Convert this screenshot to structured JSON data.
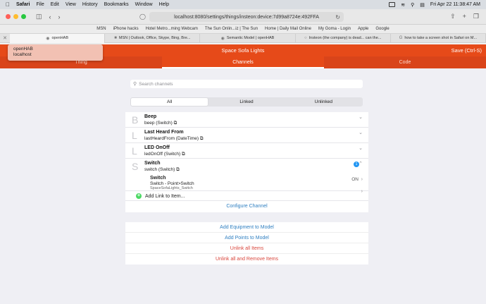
{
  "menubar": {
    "app": "Safari",
    "items": [
      "File",
      "Edit",
      "View",
      "History",
      "Bookmarks",
      "Window",
      "Help"
    ],
    "datetime": "Fri Apr 22  11:38:47 AM"
  },
  "browser": {
    "url": "localhost:8080/settings/things/insteon:device:7d99a8724e:492FFA",
    "favorites": [
      "MSN",
      "iPhone hacks",
      "Hotel Metro...ming Webcam",
      "The Sun Onlin...iz | The Sun",
      "Home | Daily Mail Online",
      "My Goma - Login",
      "Apple",
      "Google"
    ],
    "tabs": [
      "openHAB",
      "MSN | Outlook, Office, Skype, Bing, Bre...",
      "Semantic Model | openHAB",
      "Insteon (the company) is dead... can the...",
      "how to take a screen shot in Safari on M..."
    ]
  },
  "header": {
    "title": "Space Sofa Lights",
    "save": "Save (Ctrl-S)"
  },
  "server_popup": {
    "name": "openHAB",
    "host": "localhost"
  },
  "tabs": [
    "Thing",
    "Channels",
    "Code"
  ],
  "search": {
    "placeholder": "Search channels"
  },
  "filter": [
    "All",
    "Linked",
    "Unlinked"
  ],
  "channels": [
    {
      "letter": "B",
      "name": "Beep",
      "sub": "beep (Switch)"
    },
    {
      "letter": "L",
      "name": "Last Heard From",
      "sub": "lastHeardFrom (DateTime)"
    },
    {
      "letter": "L",
      "name": "LED OnOff",
      "sub": "ledOnOff (Switch)"
    },
    {
      "letter": "S",
      "name": "Switch",
      "sub": "switch (Switch)",
      "badge": "1"
    }
  ],
  "linked_item": {
    "name": "Switch",
    "sub": "Switch - Point>Switch",
    "id": "SpaceSofaLights_Switch",
    "state": "ON"
  },
  "add_link": "Add Link to Item...",
  "configure": "Configure Channel",
  "actions": {
    "equipment": "Add Equipment to Model",
    "points": "Add Points to Model",
    "unlink": "Unlink all Items",
    "unlink_remove": "Unlink all and Remove Items"
  }
}
